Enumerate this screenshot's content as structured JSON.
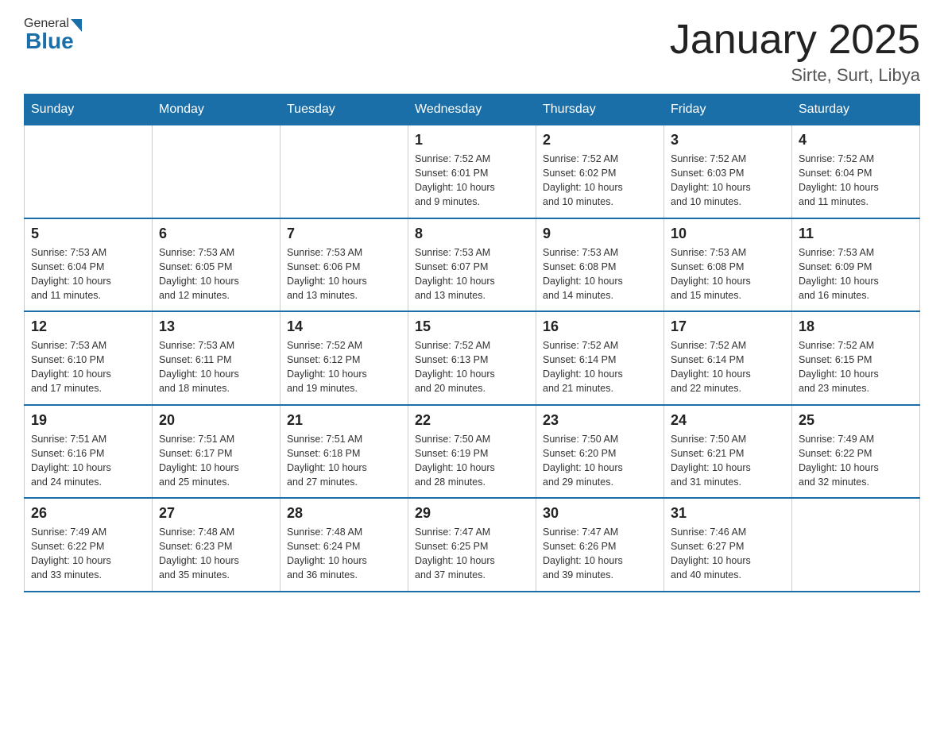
{
  "header": {
    "title": "January 2025",
    "subtitle": "Sirte, Surt, Libya",
    "logo_general": "General",
    "logo_blue": "Blue"
  },
  "weekdays": [
    "Sunday",
    "Monday",
    "Tuesday",
    "Wednesday",
    "Thursday",
    "Friday",
    "Saturday"
  ],
  "weeks": [
    [
      {
        "day": "",
        "info": ""
      },
      {
        "day": "",
        "info": ""
      },
      {
        "day": "",
        "info": ""
      },
      {
        "day": "1",
        "info": "Sunrise: 7:52 AM\nSunset: 6:01 PM\nDaylight: 10 hours\nand 9 minutes."
      },
      {
        "day": "2",
        "info": "Sunrise: 7:52 AM\nSunset: 6:02 PM\nDaylight: 10 hours\nand 10 minutes."
      },
      {
        "day": "3",
        "info": "Sunrise: 7:52 AM\nSunset: 6:03 PM\nDaylight: 10 hours\nand 10 minutes."
      },
      {
        "day": "4",
        "info": "Sunrise: 7:52 AM\nSunset: 6:04 PM\nDaylight: 10 hours\nand 11 minutes."
      }
    ],
    [
      {
        "day": "5",
        "info": "Sunrise: 7:53 AM\nSunset: 6:04 PM\nDaylight: 10 hours\nand 11 minutes."
      },
      {
        "day": "6",
        "info": "Sunrise: 7:53 AM\nSunset: 6:05 PM\nDaylight: 10 hours\nand 12 minutes."
      },
      {
        "day": "7",
        "info": "Sunrise: 7:53 AM\nSunset: 6:06 PM\nDaylight: 10 hours\nand 13 minutes."
      },
      {
        "day": "8",
        "info": "Sunrise: 7:53 AM\nSunset: 6:07 PM\nDaylight: 10 hours\nand 13 minutes."
      },
      {
        "day": "9",
        "info": "Sunrise: 7:53 AM\nSunset: 6:08 PM\nDaylight: 10 hours\nand 14 minutes."
      },
      {
        "day": "10",
        "info": "Sunrise: 7:53 AM\nSunset: 6:08 PM\nDaylight: 10 hours\nand 15 minutes."
      },
      {
        "day": "11",
        "info": "Sunrise: 7:53 AM\nSunset: 6:09 PM\nDaylight: 10 hours\nand 16 minutes."
      }
    ],
    [
      {
        "day": "12",
        "info": "Sunrise: 7:53 AM\nSunset: 6:10 PM\nDaylight: 10 hours\nand 17 minutes."
      },
      {
        "day": "13",
        "info": "Sunrise: 7:53 AM\nSunset: 6:11 PM\nDaylight: 10 hours\nand 18 minutes."
      },
      {
        "day": "14",
        "info": "Sunrise: 7:52 AM\nSunset: 6:12 PM\nDaylight: 10 hours\nand 19 minutes."
      },
      {
        "day": "15",
        "info": "Sunrise: 7:52 AM\nSunset: 6:13 PM\nDaylight: 10 hours\nand 20 minutes."
      },
      {
        "day": "16",
        "info": "Sunrise: 7:52 AM\nSunset: 6:14 PM\nDaylight: 10 hours\nand 21 minutes."
      },
      {
        "day": "17",
        "info": "Sunrise: 7:52 AM\nSunset: 6:14 PM\nDaylight: 10 hours\nand 22 minutes."
      },
      {
        "day": "18",
        "info": "Sunrise: 7:52 AM\nSunset: 6:15 PM\nDaylight: 10 hours\nand 23 minutes."
      }
    ],
    [
      {
        "day": "19",
        "info": "Sunrise: 7:51 AM\nSunset: 6:16 PM\nDaylight: 10 hours\nand 24 minutes."
      },
      {
        "day": "20",
        "info": "Sunrise: 7:51 AM\nSunset: 6:17 PM\nDaylight: 10 hours\nand 25 minutes."
      },
      {
        "day": "21",
        "info": "Sunrise: 7:51 AM\nSunset: 6:18 PM\nDaylight: 10 hours\nand 27 minutes."
      },
      {
        "day": "22",
        "info": "Sunrise: 7:50 AM\nSunset: 6:19 PM\nDaylight: 10 hours\nand 28 minutes."
      },
      {
        "day": "23",
        "info": "Sunrise: 7:50 AM\nSunset: 6:20 PM\nDaylight: 10 hours\nand 29 minutes."
      },
      {
        "day": "24",
        "info": "Sunrise: 7:50 AM\nSunset: 6:21 PM\nDaylight: 10 hours\nand 31 minutes."
      },
      {
        "day": "25",
        "info": "Sunrise: 7:49 AM\nSunset: 6:22 PM\nDaylight: 10 hours\nand 32 minutes."
      }
    ],
    [
      {
        "day": "26",
        "info": "Sunrise: 7:49 AM\nSunset: 6:22 PM\nDaylight: 10 hours\nand 33 minutes."
      },
      {
        "day": "27",
        "info": "Sunrise: 7:48 AM\nSunset: 6:23 PM\nDaylight: 10 hours\nand 35 minutes."
      },
      {
        "day": "28",
        "info": "Sunrise: 7:48 AM\nSunset: 6:24 PM\nDaylight: 10 hours\nand 36 minutes."
      },
      {
        "day": "29",
        "info": "Sunrise: 7:47 AM\nSunset: 6:25 PM\nDaylight: 10 hours\nand 37 minutes."
      },
      {
        "day": "30",
        "info": "Sunrise: 7:47 AM\nSunset: 6:26 PM\nDaylight: 10 hours\nand 39 minutes."
      },
      {
        "day": "31",
        "info": "Sunrise: 7:46 AM\nSunset: 6:27 PM\nDaylight: 10 hours\nand 40 minutes."
      },
      {
        "day": "",
        "info": ""
      }
    ]
  ]
}
